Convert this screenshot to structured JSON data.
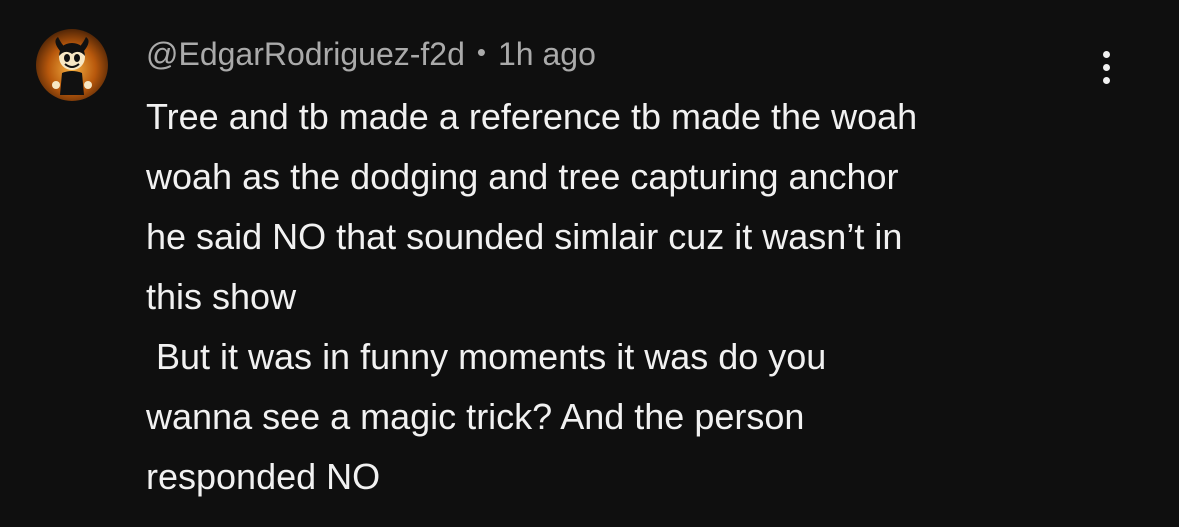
{
  "comment": {
    "author": "@EdgarRodriguez-f2d",
    "separator": "•",
    "time": "1h ago",
    "avatar_icon": "cartoon-character-avatar",
    "more_icon": "more-vertical-icon",
    "lines": [
      "Tree and tb made a reference tb made the woah",
      "woah as the dodging and tree capturing anchor",
      "he said NO that sounded simlair cuz it wasn’t in",
      "this show",
      " But it was in funny moments it was do you",
      "wanna see a magic trick? And the person",
      "responded NO"
    ]
  },
  "colors": {
    "background": "#0f0f0f",
    "text_primary": "#f1f1f1",
    "text_secondary": "#aaaaaa",
    "avatar_accent": "#e08a1e"
  }
}
